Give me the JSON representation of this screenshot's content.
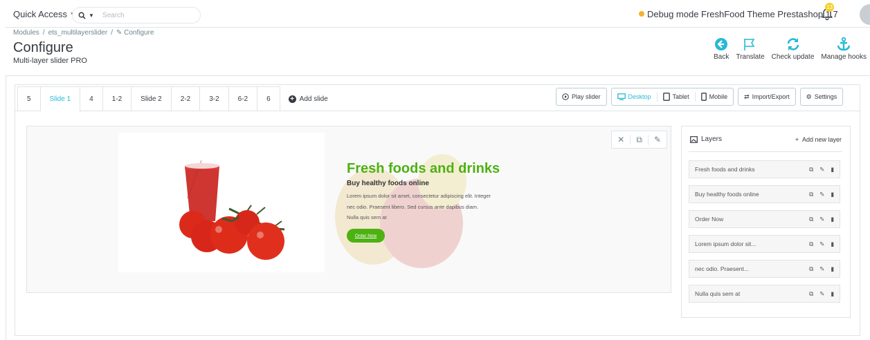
{
  "header": {
    "quick_access": "Quick Access",
    "search_placeholder": "Search",
    "debug_label": "Debug mode",
    "shop_name": "FreshFood Theme Prestashop 1.7",
    "notification_count": "13"
  },
  "page": {
    "breadcrumb": [
      "Modules",
      "/",
      "ets_multilayerslider",
      "/",
      "Configure"
    ],
    "title": "Configure",
    "subtitle": "Multi-layer slider PRO"
  },
  "toolbar": {
    "back": "Back",
    "translate": "Translate",
    "check_update": "Check update",
    "manage_hooks": "Manage hooks"
  },
  "tabs": [
    "5",
    "Slide 1",
    "4",
    "1-2",
    "Slide 2",
    "2-2",
    "3-2",
    "6-2",
    "6"
  ],
  "active_tab": "Slide 1",
  "add_slide": "Add slide",
  "actions": {
    "play_slider": "Play slider",
    "desktop": "Desktop",
    "tablet": "Tablet",
    "mobile": "Mobile",
    "import_export": "Import/Export",
    "settings": "Settings"
  },
  "slide": {
    "heading": "Fresh foods and drinks",
    "subheading": "Buy healthy foods online",
    "text_line1": "Lorem ipsum dolor sit amet, consectetur adipiscing elit. Integer",
    "text_line2": "nec odio. Praesent libero. Sed cursus ante dapibus diam.",
    "text_line3": "Nulla quis sem at",
    "button": "Order Now"
  },
  "layers_panel": {
    "title": "Layers",
    "add_new": "Add new layer",
    "items": [
      "Fresh foods and drinks",
      "Buy healthy foods online",
      "Order Now",
      "Lorem ipsum dolor sit...",
      "nec odio. Praesent...",
      "Nulla quis sem at"
    ]
  },
  "colors": {
    "accent": "#25b9d7",
    "heading_green": "#4db112",
    "debug_dot": "#f4b12e"
  }
}
